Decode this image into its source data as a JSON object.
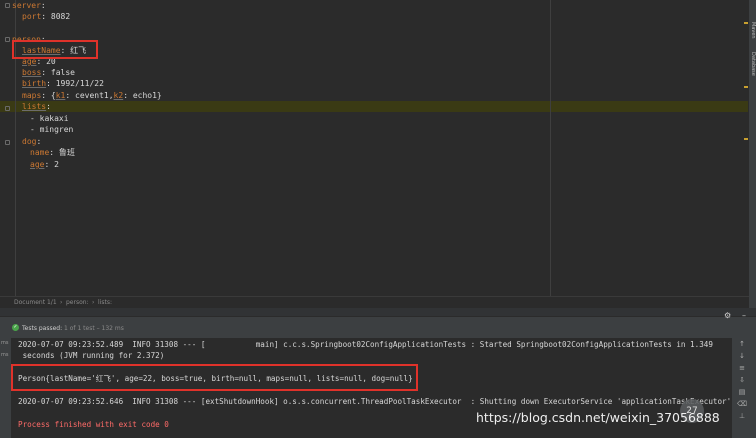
{
  "editor": {
    "lines": {
      "server_key": "server",
      "port_key": "port",
      "port_value": "8082",
      "person_key": "person",
      "lastName_key": "lastName",
      "lastName_value": "红飞",
      "age_key": "age",
      "age_value": "20",
      "boss_key": "boss",
      "boss_value": "false",
      "birth_key": "birth",
      "birth_value": "1992/11/22",
      "maps_key": "maps",
      "maps_k1": "k1",
      "maps_v1": "cevent1",
      "maps_k2": "k2",
      "maps_v2": "echo1",
      "lists_key": "lists",
      "list_item_1": "kakaxi",
      "list_item_2": "mingren",
      "dog_key": "dog",
      "dog_name_key": "name",
      "dog_name_value": "鲁班",
      "dog_age_key": "age",
      "dog_age_value": "2"
    }
  },
  "right_strip": {
    "label_1": "Maven",
    "label_2": "Database"
  },
  "status_bar": {
    "document": "Document 1/1",
    "crumb_1": "person:",
    "crumb_2": "lists:"
  },
  "test_panel": {
    "tests_passed": "Tests passed:",
    "tests_count": "1 of 1 test – 132 ms"
  },
  "left_tab": {
    "item_1": "ms",
    "item_2": "ms"
  },
  "console": {
    "line_1": "2020-07-07 09:23:52.489  INFO 31308 --- [           main] c.c.s.Springboot02ConfigApplicationTests : Started Springboot02ConfigApplicationTests in 1.349",
    "line_2": " seconds (JVM running for 2.372)",
    "line_3": "Person{lastName='红飞', age=22, boss=true, birth=null, maps=null, lists=null, dog=null}",
    "line_4": "2020-07-07 09:23:52.646  INFO 31308 --- [extShutdownHook] o.s.s.concurrent.ThreadPoolTaskExecutor  : Shutting down ExecutorService 'applicationTaskExecutor'",
    "line_5": "Process finished with exit code 0"
  },
  "watermark": "https://blog.csdn.net/weixin_37056888",
  "badge": "27",
  "colors": {
    "annotation": "#e0322a",
    "key": "#cc7832",
    "process": "#ff6b68",
    "passed": "#4aa44a"
  }
}
